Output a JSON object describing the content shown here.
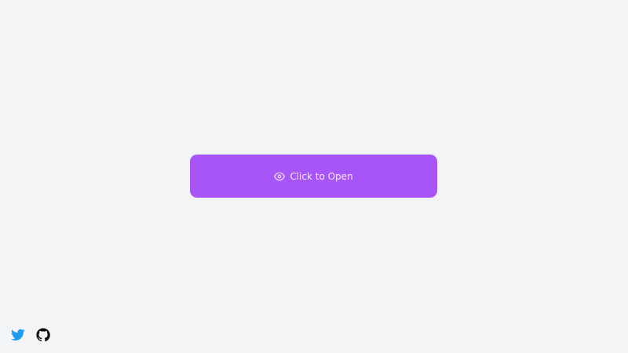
{
  "main": {
    "open_button": {
      "label": "Click to Open",
      "icon": "eye-icon",
      "background_color": "#a855f7",
      "text_color": "#f3e8ff"
    }
  },
  "footer": {
    "social_links": [
      {
        "icon": "twitter-icon",
        "color": "#1d9bf0"
      },
      {
        "icon": "github-icon",
        "color": "#111111"
      }
    ]
  },
  "page": {
    "background_color": "#f3f4f6"
  }
}
